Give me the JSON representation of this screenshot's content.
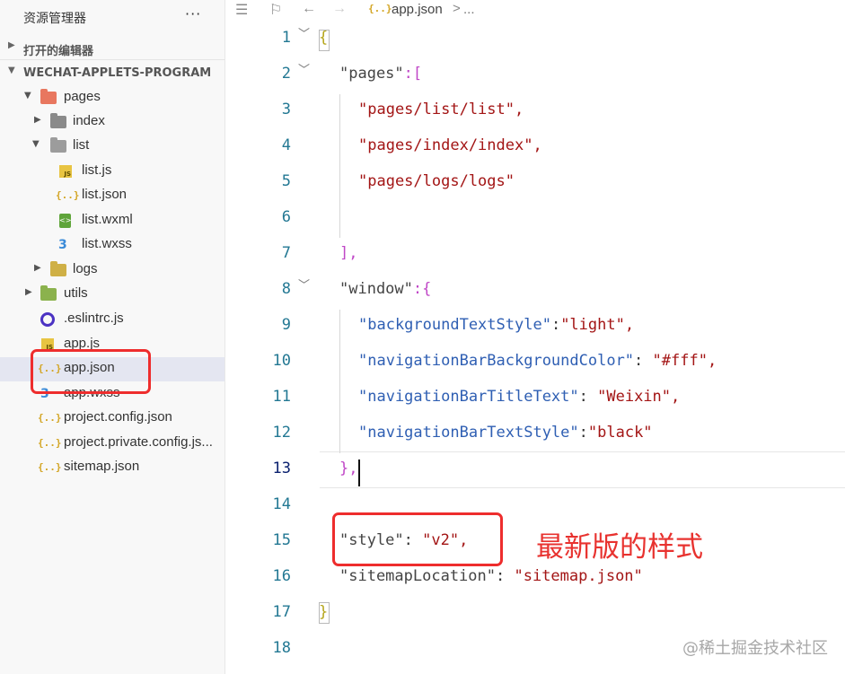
{
  "sidebar": {
    "title": "资源管理器",
    "more": "···",
    "section_open_editors": "打开的编辑器",
    "section_project": "WECHAT-APPLETS-PROGRAM",
    "tree": [
      {
        "name": "pages",
        "icon": "folder-open-red-icon"
      },
      {
        "name": "index",
        "icon": "folder-icon"
      },
      {
        "name": "list",
        "icon": "folder-open-icon"
      },
      {
        "name": "list.js",
        "icon": "js-file-icon"
      },
      {
        "name": "list.json",
        "icon": "json-file-icon"
      },
      {
        "name": "list.wxml",
        "icon": "wxml-file-icon"
      },
      {
        "name": "list.wxss",
        "icon": "css-file-icon"
      },
      {
        "name": "logs",
        "icon": "folder-icon"
      },
      {
        "name": "utils",
        "icon": "folder-green-icon"
      },
      {
        "name": ".eslintrc.js",
        "icon": "eslint-icon"
      },
      {
        "name": "app.js",
        "icon": "js-file-icon"
      },
      {
        "name": "app.json",
        "icon": "json-file-icon"
      },
      {
        "name": "app.wxss",
        "icon": "css-file-icon"
      },
      {
        "name": "project.config.json",
        "icon": "json-file-icon"
      },
      {
        "name": "project.private.config.js...",
        "icon": "json-file-icon"
      },
      {
        "name": "sitemap.json",
        "icon": "json-file-icon"
      }
    ]
  },
  "breadcrumb": {
    "file": "app.json",
    "separator": ">",
    "rest": "..."
  },
  "editor": {
    "line_numbers": [
      "1",
      "2",
      "3",
      "4",
      "5",
      "6",
      "7",
      "8",
      "9",
      "10",
      "11",
      "12",
      "13",
      "14",
      "15",
      "16",
      "17",
      "18"
    ],
    "current_line": "13",
    "lines": {
      "l1": "{",
      "l2_key": "\"pages\"",
      "l2_rest": ":[",
      "l3": "\"pages/list/list\",",
      "l4": "\"pages/index/index\",",
      "l5": "\"pages/logs/logs\"",
      "l7": "],",
      "l8_key": "\"window\"",
      "l8_rest": ":{",
      "l9_key": "\"backgroundTextStyle\"",
      "l9_sep": ":",
      "l9_val": "\"light\",",
      "l10_key": "\"navigationBarBackgroundColor\"",
      "l10_sep": ": ",
      "l10_val": "\"#fff\",",
      "l11_key": "\"navigationBarTitleText\"",
      "l11_sep": ": ",
      "l11_val": "\"Weixin\",",
      "l12_key": "\"navigationBarTextStyle\"",
      "l12_sep": ":",
      "l12_val": "\"black\"",
      "l13": "},",
      "l15_key": "\"style\"",
      "l15_sep": ": ",
      "l15_val": "\"v2\",",
      "l16_key": "\"sitemapLocation\"",
      "l16_sep": ": ",
      "l16_val": "\"sitemap.json\"",
      "l17": "}"
    }
  },
  "annotation": {
    "text": "最新版的样式",
    "color": "#ee2d2d"
  },
  "watermark": "@稀土掘金技术社区"
}
